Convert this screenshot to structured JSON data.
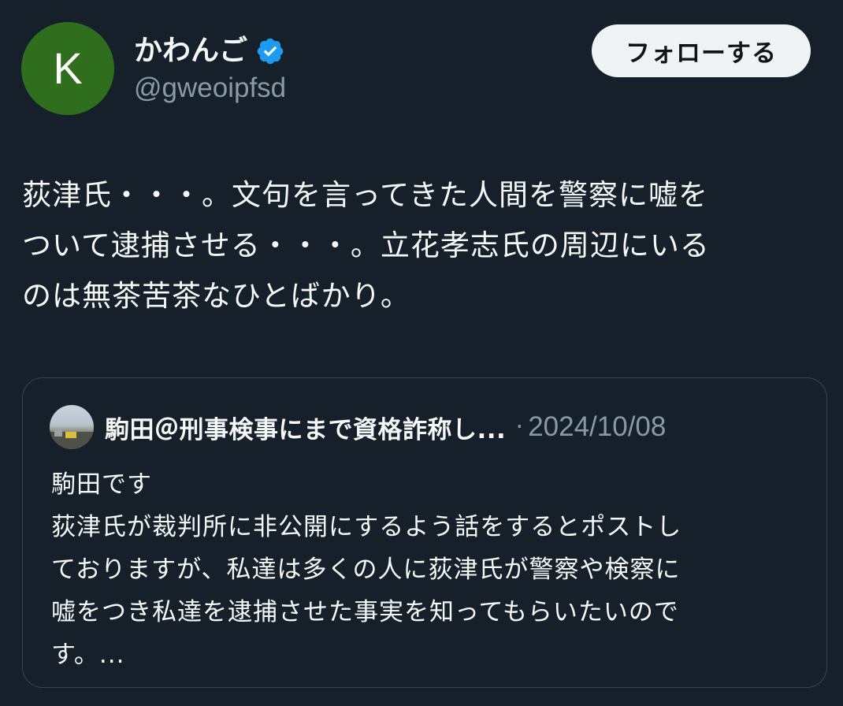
{
  "author": {
    "avatar_letter": "K",
    "avatar_color": "#2e6e1d",
    "display_name": "かわんご",
    "verified_icon": "verified-badge-icon",
    "handle": "@gweoipfsd"
  },
  "follow_button": {
    "label": "フォローする"
  },
  "tweet": {
    "lines": [
      "荻津氏・・・。文句を言ってきた人間を警察に嘘を",
      "ついて逮捕させる・・・。立花孝志氏の周辺にいる",
      "のは無茶苦茶なひとばかり。"
    ]
  },
  "quote": {
    "name": "駒田＠刑事検事にまで資格詐称し...",
    "separator": "·",
    "date": "2024/10/08",
    "body_lines": [
      "駒田です",
      "荻津氏が裁判所に非公開にするよう話をするとポストし",
      "ておりますが、私達は多くの人に荻津氏が警察や検察に",
      "嘘をつき私達を逮捕させた事実を知ってもらいたいので",
      "す。..."
    ]
  },
  "colors": {
    "background": "#15202b",
    "text": "#f7f9f9",
    "secondary_text": "#8b98a5",
    "verified_blue": "#1d9bf0",
    "border": "#38444d"
  }
}
